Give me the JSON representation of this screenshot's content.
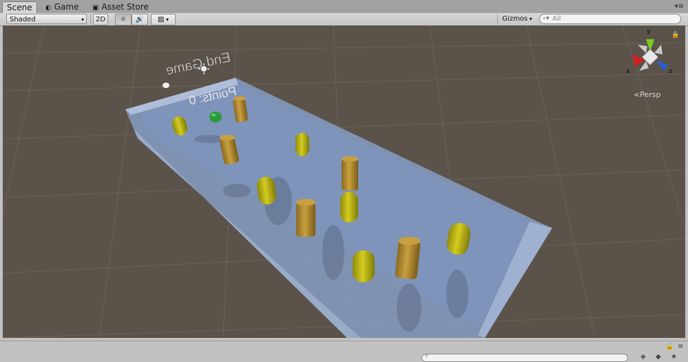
{
  "tabs": [
    {
      "label": "Scene",
      "icon": "scene-icon",
      "active": true
    },
    {
      "label": "Game",
      "icon": "game-controller-icon",
      "active": false
    },
    {
      "label": "Asset Store",
      "icon": "shopping-bag-icon",
      "active": false
    }
  ],
  "toolbar": {
    "shading_mode": "Shaded",
    "mode_2d_label": "2D",
    "gizmos_label": "Gizmos",
    "search_placeholder": "All"
  },
  "scene": {
    "end_game_text": "End Game",
    "points_text": "Points: 0",
    "projection_label": "Persp",
    "axis_labels": {
      "x": "x",
      "y": "y",
      "z": "z"
    },
    "colors": {
      "background": "#5b5249",
      "grid": "#6b6359",
      "board": "#8aa2c8",
      "bottle_yellow": "#b8b010",
      "bottle_orange": "#b89430",
      "ball_green": "#2a9a3a",
      "gizmo_x": "#d42020",
      "gizmo_y": "#7acc22",
      "gizmo_z": "#2a5cd8"
    }
  }
}
